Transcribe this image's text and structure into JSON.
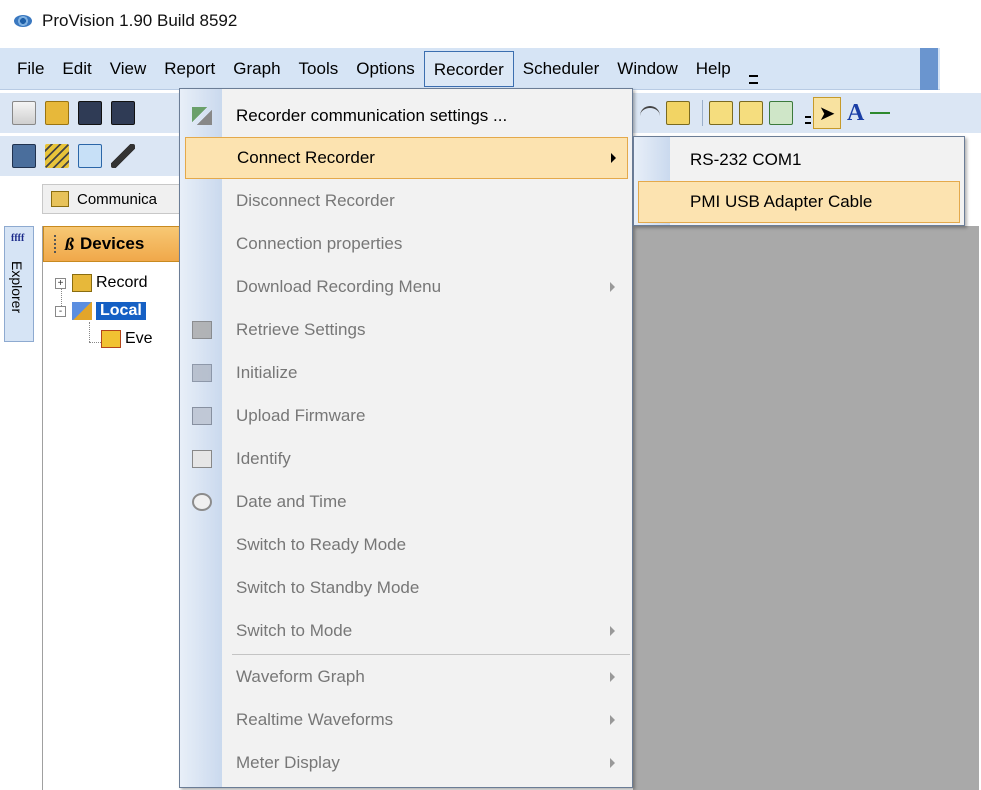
{
  "window": {
    "title": "ProVision 1.90 Build 8592"
  },
  "menubar": {
    "items": [
      {
        "label": "File"
      },
      {
        "label": "Edit"
      },
      {
        "label": "View"
      },
      {
        "label": "Report"
      },
      {
        "label": "Graph"
      },
      {
        "label": "Tools"
      },
      {
        "label": "Options"
      },
      {
        "label": "Recorder",
        "active": true
      },
      {
        "label": "Scheduler"
      },
      {
        "label": "Window"
      },
      {
        "label": "Help"
      }
    ]
  },
  "toolbar": {
    "text_tool": "A"
  },
  "doc_tab": {
    "label": "Communica"
  },
  "explorer": {
    "tab_label": "Explorer",
    "icon_text": "ffff"
  },
  "devices": {
    "header": "Devices",
    "header_icon": "ß",
    "tree": [
      {
        "label": "Record",
        "expander": "+"
      },
      {
        "label": "Local",
        "expander": "-",
        "selected": true
      },
      {
        "label": "Eve"
      }
    ]
  },
  "recorder_menu": {
    "items": [
      {
        "label": "Recorder communication settings ...",
        "enabled": true,
        "icon": "comm-settings-icon"
      },
      {
        "label": "Connect Recorder",
        "enabled": true,
        "submenu": true,
        "highlight": true
      },
      {
        "label": "Disconnect Recorder",
        "enabled": false
      },
      {
        "label": "Connection properties",
        "enabled": false
      },
      {
        "label": "Download Recording Menu",
        "enabled": false,
        "submenu": true
      },
      {
        "label": "Retrieve Settings",
        "enabled": false,
        "icon": "retrieve-settings-icon"
      },
      {
        "label": "Initialize",
        "enabled": false,
        "icon": "initialize-icon"
      },
      {
        "label": "Upload Firmware",
        "enabled": false,
        "icon": "upload-firmware-icon"
      },
      {
        "label": "Identify",
        "enabled": false,
        "icon": "identify-icon"
      },
      {
        "label": "Date and Time",
        "enabled": false,
        "icon": "clock-icon"
      },
      {
        "label": "Switch to Ready Mode",
        "enabled": false
      },
      {
        "label": "Switch to Standby Mode",
        "enabled": false
      },
      {
        "label": "Switch to Mode",
        "enabled": false,
        "submenu": true
      },
      {
        "label": "Waveform Graph",
        "enabled": false,
        "submenu": true
      },
      {
        "label": "Realtime Waveforms",
        "enabled": false,
        "submenu": true
      },
      {
        "label": "Meter Display",
        "enabled": false,
        "submenu": true
      }
    ]
  },
  "connect_submenu": {
    "items": [
      {
        "label": "RS-232 COM1"
      },
      {
        "label": "PMI USB Adapter Cable",
        "highlight": true
      }
    ]
  },
  "colors": {
    "menubar_bg": "#d6e4f5",
    "highlight_bg": "#fce3b0",
    "highlight_border": "#e4a94b",
    "selection_blue": "#1560c4",
    "panel_header": "#f0a84a"
  }
}
